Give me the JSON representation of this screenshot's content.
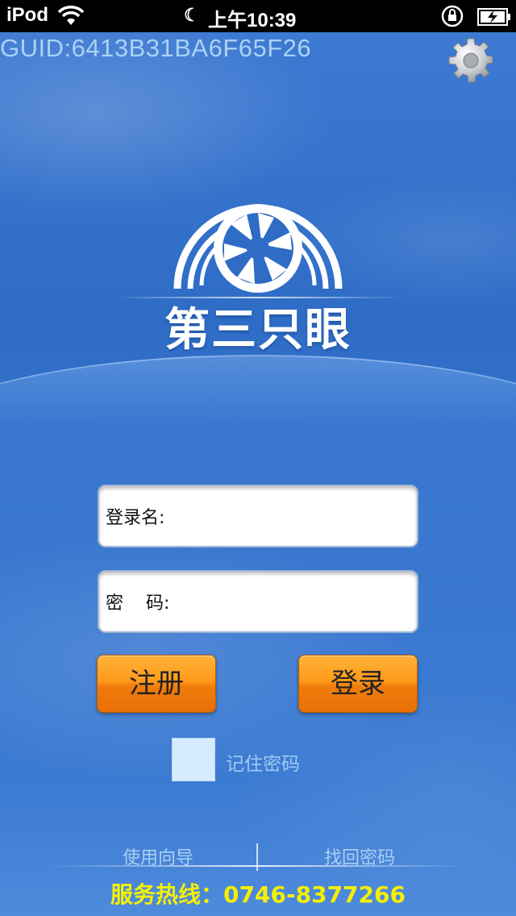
{
  "statusbar": {
    "carrier": "iPod",
    "time": "上午10:39",
    "icons": [
      "wifi-icon",
      "moon-icon",
      "rotation-lock-icon",
      "battery-charging-icon"
    ]
  },
  "guid": "GUID:6413B31BA6F65F26",
  "settings_icon": "gear-icon",
  "logo": {
    "brand_text": "第三只眼",
    "icon": "camera-aperture-icon"
  },
  "form": {
    "username_label": "登录名:",
    "username_value": "",
    "password_label": "密    码:",
    "password_value": "",
    "register_label": "注册",
    "login_label": "登录",
    "remember_label": "记住密码",
    "remember_checked": false
  },
  "footer": {
    "guide_link": "使用向导",
    "recover_link": "找回密码",
    "hotline": "服务热线：0746-8377266"
  },
  "colors": {
    "background": "#2e6cc6",
    "button": "#ff9a1a",
    "hotline": "#f5f000",
    "guid_text": "#a9d2f5"
  }
}
